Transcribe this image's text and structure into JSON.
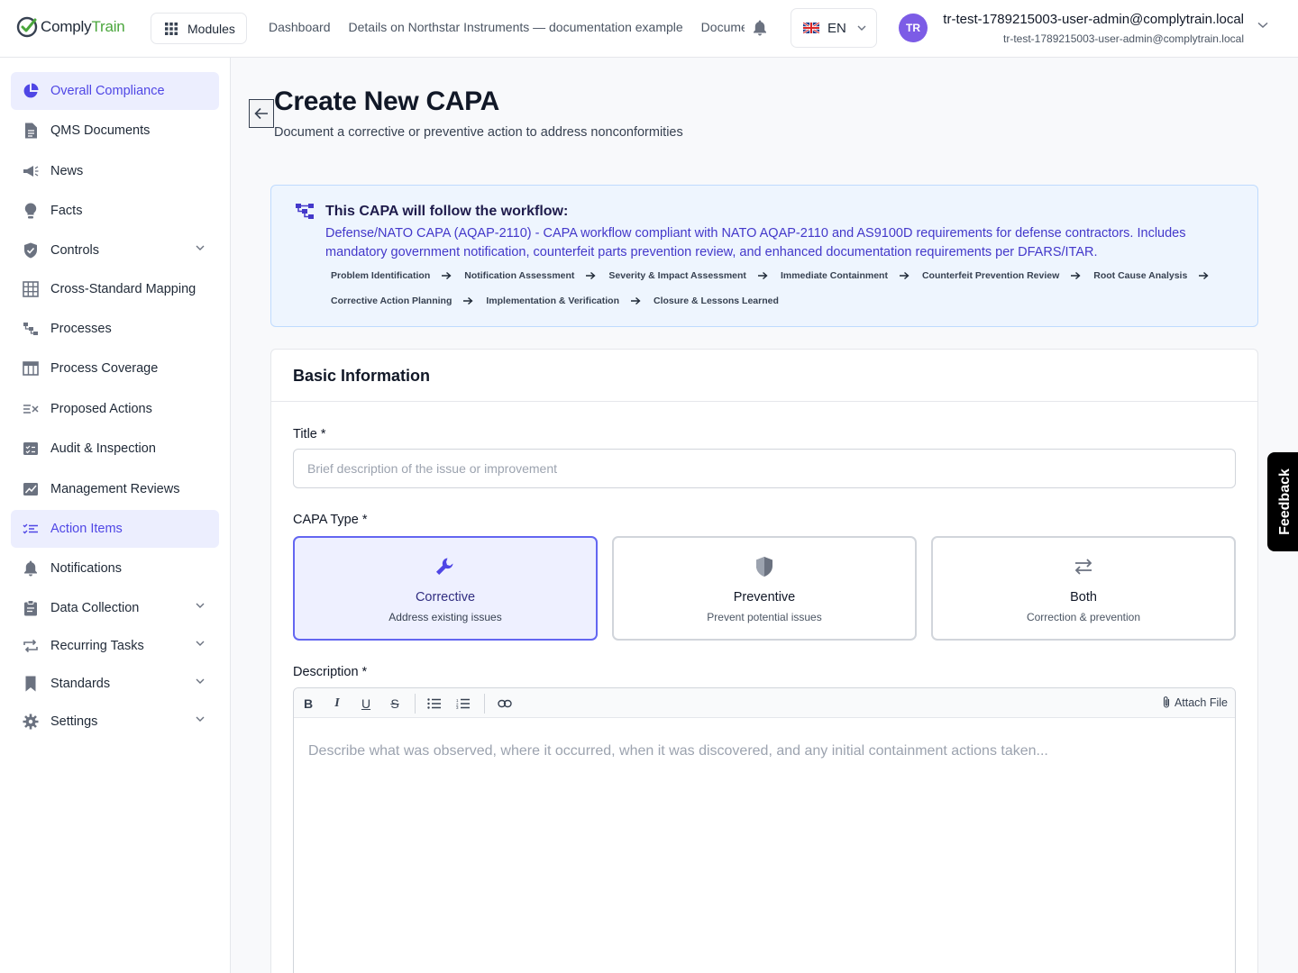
{
  "app": {
    "logo_comply": "Comply",
    "logo_train": "Train",
    "modules_label": "Modules",
    "nav_links": [
      "Dashboard",
      "Details on Northstar Instruments — documentation example",
      "Documents"
    ],
    "language": "EN",
    "user": {
      "initials": "TR",
      "name": "tr-test-1789215003-user-admin@complytrain.local",
      "email": "tr-test-1789215003-user-admin@complytrain.local"
    }
  },
  "sidebar": {
    "items": [
      {
        "label": "Overall Compliance",
        "icon": "pie-chart-icon",
        "active": true
      },
      {
        "label": "QMS Documents",
        "icon": "document-icon"
      },
      {
        "label": "News",
        "icon": "megaphone-icon"
      },
      {
        "label": "Facts",
        "icon": "lightbulb-icon"
      },
      {
        "label": "Controls",
        "icon": "shield-icon",
        "expandable": true
      },
      {
        "label": "Cross-Standard Mapping",
        "icon": "grid-icon"
      },
      {
        "label": "Processes",
        "icon": "process-icon"
      },
      {
        "label": "Process Coverage",
        "icon": "table-icon"
      },
      {
        "label": "Proposed Actions",
        "icon": "list-x-icon"
      },
      {
        "label": "Audit & Inspection",
        "icon": "checklist-icon"
      },
      {
        "label": "Management Reviews",
        "icon": "chart-line-icon"
      },
      {
        "label": "Action Items",
        "icon": "list-check-icon",
        "active": true
      },
      {
        "label": "Notifications",
        "icon": "bell-icon"
      },
      {
        "label": "Data Collection",
        "icon": "clipboard-icon",
        "expandable": true
      },
      {
        "label": "Recurring Tasks",
        "icon": "repeat-icon",
        "expandable": true
      },
      {
        "label": "Standards",
        "icon": "bookmark-icon",
        "expandable": true
      },
      {
        "label": "Settings",
        "icon": "gear-icon",
        "expandable": true
      }
    ]
  },
  "page": {
    "title": "Create New CAPA",
    "subtitle": "Document a corrective or preventive action to address nonconformities"
  },
  "workflow": {
    "title": "This CAPA will follow the workflow:",
    "description": "Defense/NATO CAPA (AQAP-2110) - CAPA workflow compliant with NATO AQAP-2110 and AS9100D requirements for defense contractors. Includes mandatory government notification, counterfeit parts prevention review, and enhanced documentation requirements per DFARS/ITAR.",
    "steps": [
      "Problem Identification",
      "Notification Assessment",
      "Severity & Impact Assessment",
      "Immediate Containment",
      "Counterfeit Prevention Review",
      "Root Cause Analysis",
      "Corrective Action Planning",
      "Implementation & Verification",
      "Closure & Lessons Learned"
    ]
  },
  "form": {
    "section_title": "Basic Information",
    "title_label": "Title *",
    "title_placeholder": "Brief description of the issue or improvement",
    "title_value": "",
    "type_label": "CAPA Type *",
    "types": [
      {
        "name": "Corrective",
        "desc": "Address existing issues",
        "icon": "wrench-icon",
        "selected": true
      },
      {
        "name": "Preventive",
        "desc": "Prevent potential issues",
        "icon": "shield-icon",
        "selected": false
      },
      {
        "name": "Both",
        "desc": "Correction & prevention",
        "icon": "swap-arrows-icon",
        "selected": false
      }
    ],
    "description_label": "Description *",
    "attach_label": "Attach File",
    "description_placeholder": "Describe what was observed, where it occurred, when it was discovered, and any initial containment actions taken..."
  },
  "feedback_label": "Feedback",
  "colors": {
    "accent": "#4f46e5",
    "brand_green": "#4aa63c",
    "avatar": "#7c5ce6",
    "workflow_bg": "#eef5fe",
    "workflow_text": "#4338ca"
  }
}
